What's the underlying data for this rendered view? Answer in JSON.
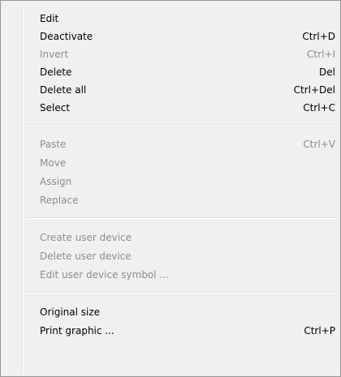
{
  "menu": {
    "group1": [
      {
        "label": "Edit",
        "shortcut": "",
        "enabled": true
      },
      {
        "label": "Deactivate",
        "shortcut": "Ctrl+D",
        "enabled": true
      },
      {
        "label": "Invert",
        "shortcut": "Ctrl+I",
        "enabled": false
      },
      {
        "label": "Delete",
        "shortcut": "Del",
        "enabled": true
      },
      {
        "label": "Delete all",
        "shortcut": "Ctrl+Del",
        "enabled": true
      },
      {
        "label": "Select",
        "shortcut": "Ctrl+C",
        "enabled": true
      }
    ],
    "group2": [
      {
        "label": "Paste",
        "shortcut": "Ctrl+V",
        "enabled": false
      },
      {
        "label": "Move",
        "shortcut": "",
        "enabled": false
      },
      {
        "label": "Assign",
        "shortcut": "",
        "enabled": false
      },
      {
        "label": "Replace",
        "shortcut": "",
        "enabled": false
      }
    ],
    "group3": [
      {
        "label": "Create user device",
        "shortcut": "",
        "enabled": false
      },
      {
        "label": "Delete user device",
        "shortcut": "",
        "enabled": false
      },
      {
        "label": "Edit user device symbol ...",
        "shortcut": "",
        "enabled": false
      }
    ],
    "group4": [
      {
        "label": "Original size",
        "shortcut": "",
        "enabled": true
      },
      {
        "label": "Print graphic ...",
        "shortcut": "Ctrl+P",
        "enabled": true
      }
    ]
  },
  "colors": {
    "menu_background": "#f0f0f0",
    "menu_border": "#979797",
    "enabled_text": "#000000",
    "disabled_text": "#8d8d8d"
  }
}
